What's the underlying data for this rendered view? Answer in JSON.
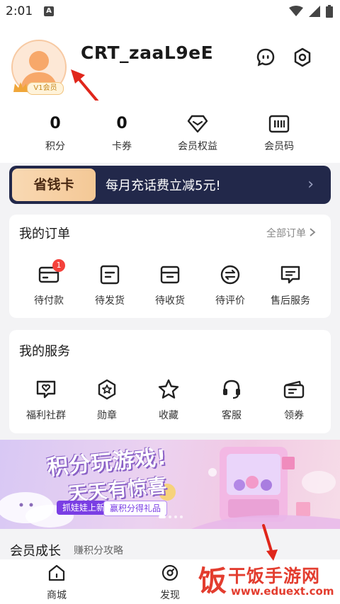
{
  "status_bar": {
    "time": "2:01",
    "notification_letter": "A"
  },
  "profile": {
    "username": "CRT_zaaL9eE",
    "vip_label": "V1会员"
  },
  "stats": [
    {
      "value": "0",
      "label": "积分"
    },
    {
      "value": "0",
      "label": "卡券"
    },
    {
      "label": "会员权益",
      "icon": "diamond-icon"
    },
    {
      "label": "会员码",
      "icon": "barcode-icon"
    }
  ],
  "savings_card": {
    "tag": "省钱卡",
    "text": "每月充话费立减5元!",
    "arrow": "›"
  },
  "orders": {
    "title": "我的订单",
    "all_link": "全部订单",
    "items": [
      {
        "label": "待付款",
        "badge": "1"
      },
      {
        "label": "待发货"
      },
      {
        "label": "待收货"
      },
      {
        "label": "待评价"
      },
      {
        "label": "售后服务"
      }
    ]
  },
  "services": {
    "title": "我的服务",
    "items": [
      {
        "label": "福利社群"
      },
      {
        "label": "勋章"
      },
      {
        "label": "收藏"
      },
      {
        "label": "客服"
      },
      {
        "label": "领券"
      }
    ]
  },
  "promo": {
    "line1": "积分玩游戏!",
    "line2": "天天有惊喜",
    "pill1": "抓娃娃上新",
    "pill2": "赢积分得礼品"
  },
  "growth": {
    "title": "会员成长",
    "subtitle": "赚积分攻略"
  },
  "tabbar": {
    "tab1": "商城",
    "tab2": "发现"
  },
  "watermark": {
    "name": "干饭手游网",
    "url": "www.eduext.com",
    "logo_char": "饭"
  },
  "colors": {
    "accent": "#f4413b",
    "card_bg": "#22284a",
    "card_tag": "#f4c896",
    "annotation_arrow": "#e0261b"
  }
}
